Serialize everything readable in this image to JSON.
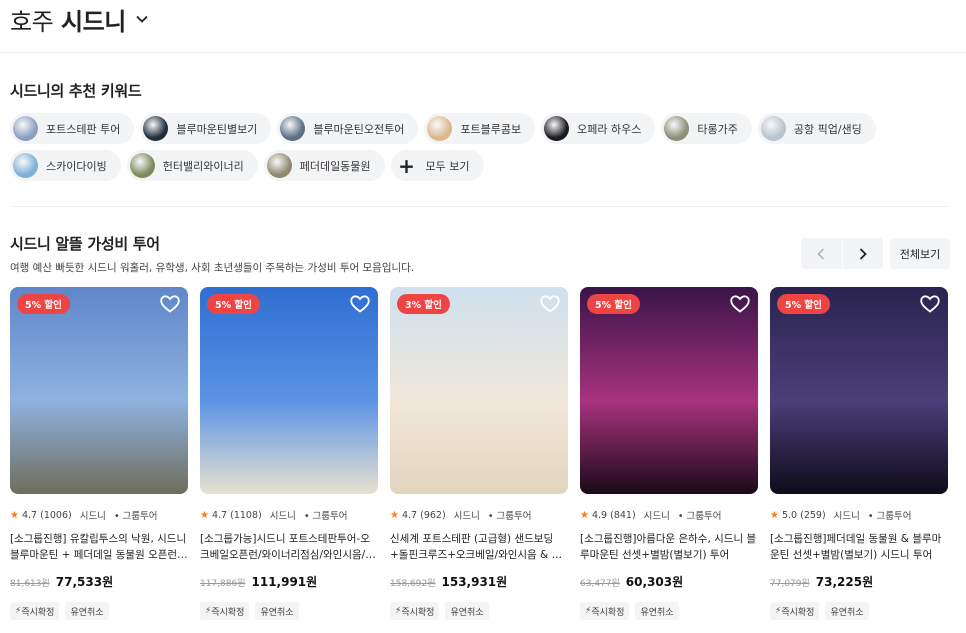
{
  "header": {
    "city_prefix": "호주",
    "city_name": "시드니"
  },
  "keywords": {
    "title": "시드니의 추천 키워드",
    "items": [
      {
        "label": "포트스테판 투어",
        "color": "#8aa0c0"
      },
      {
        "label": "블루마운틴별보기",
        "color": "#1f2d3a"
      },
      {
        "label": "블루마운틴오전투어",
        "color": "#5b6f85"
      },
      {
        "label": "포트블루콤보",
        "color": "#d9b98a"
      },
      {
        "label": "오페라 하우스",
        "color": "#1a1a22"
      },
      {
        "label": "타롱가주",
        "color": "#8c8f76"
      },
      {
        "label": "공항 픽업/샌딩",
        "color": "#b9c4cf"
      },
      {
        "label": "스카이다이빙",
        "color": "#7fb1d6"
      },
      {
        "label": "헌터밸리와이너리",
        "color": "#7d8a5b"
      },
      {
        "label": "페더데일동물원",
        "color": "#8f8a6e"
      }
    ],
    "more_label": "모두 보기"
  },
  "tours": {
    "title": "시드니 알뜰 가성비 투어",
    "subtitle": "여행 예산 빠듯한 시드니 워홀러, 유학생, 사회 초년생들이 주목하는 가성비 투어 모음입니다.",
    "view_all": "전체보기",
    "cards": [
      {
        "badge": "5% 할인",
        "rating": "4.7",
        "reviews": "(1006)",
        "location": "시드니",
        "type": "• 그룹투어",
        "title": "[소그룹진행] 유칼립투스의 낙원, 시드니 블루마운틴 + 페더데일 동물원 오픈런 ...",
        "orig_price": "81,613원",
        "price": "77,533원",
        "tags": [
          "즉시확정",
          "유연취소"
        ],
        "colors": [
          "#5f86c9",
          "#8fb2df",
          "#6f6d5c"
        ]
      },
      {
        "badge": "5% 할인",
        "rating": "4.7",
        "reviews": "(1108)",
        "location": "시드니",
        "type": "• 그룹투어",
        "title": "[소그룹가능]시드니 포트스테판투어-오크베일오픈런/와이너리점심/와인시음/모...",
        "orig_price": "117,886원",
        "price": "111,991원",
        "tags": [
          "즉시확정",
          "유연취소"
        ],
        "colors": [
          "#2f6ed1",
          "#5b93e4",
          "#e9e2d2"
        ]
      },
      {
        "badge": "3% 할인",
        "rating": "4.7",
        "reviews": "(962)",
        "location": "시드니",
        "type": "• 그룹투어",
        "title": "신세계 포트스테판 (고급형) 샌드보딩+돌핀크루즈+오크베일/와인시음 & 시티워...",
        "orig_price": "158,692원",
        "price": "153,931원",
        "tags": [
          "즉시확정",
          "유연취소"
        ],
        "colors": [
          "#cfe0ee",
          "#f0e7da",
          "#e3d4bd"
        ]
      },
      {
        "badge": "5% 할인",
        "rating": "4.9",
        "reviews": "(841)",
        "location": "시드니",
        "type": "• 그룹투어",
        "title": "[소그룹진행]아름다운 은하수, 시드니 블루마운틴 선셋+별밤(별보기) 투어",
        "orig_price": "63,477원",
        "price": "60,303원",
        "tags": [
          "즉시확정",
          "유연취소"
        ],
        "colors": [
          "#3a1548",
          "#a8327e",
          "#1a0a18"
        ]
      },
      {
        "badge": "5% 할인",
        "rating": "5.0",
        "reviews": "(259)",
        "location": "시드니",
        "type": "• 그룹투어",
        "title": "[소그룹진행]페더데일 동물원 & 블루마운틴 선셋+별밤(별보기) 시드니 투어",
        "orig_price": "77,079원",
        "price": "73,225원",
        "tags": [
          "즉시확정",
          "유연취소"
        ],
        "colors": [
          "#2a2450",
          "#4c3e78",
          "#0e0b1c"
        ]
      }
    ]
  }
}
